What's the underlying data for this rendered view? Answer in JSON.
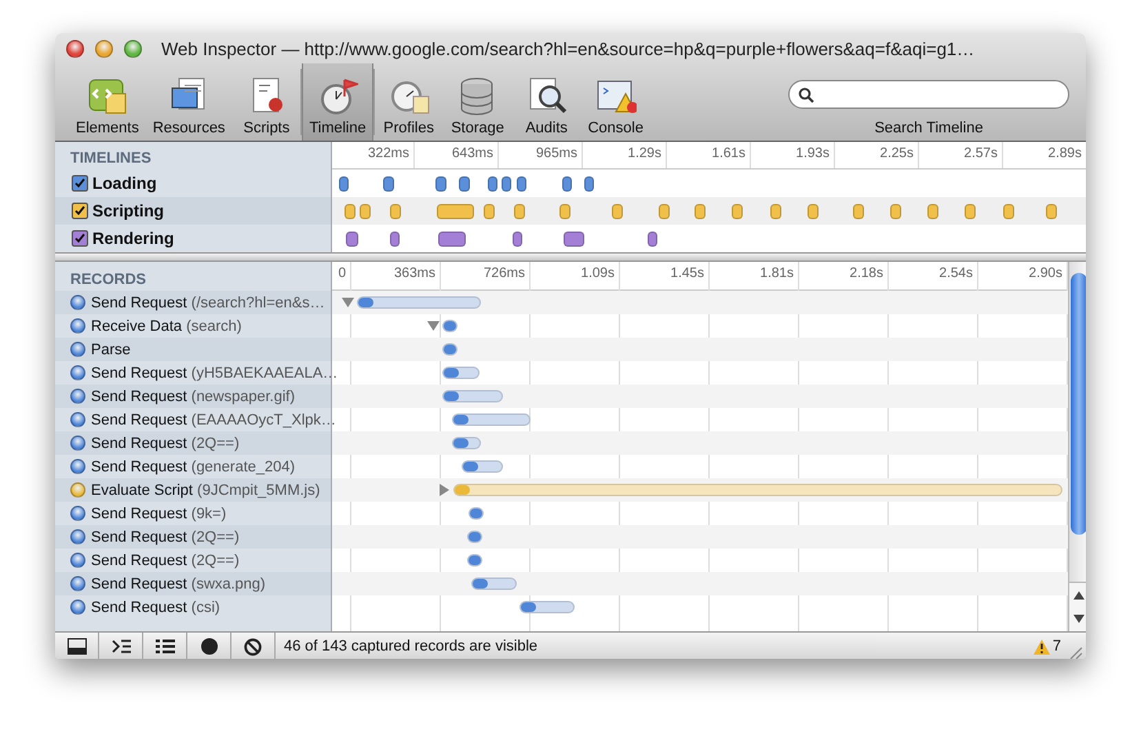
{
  "window": {
    "title": "Web Inspector — http://www.google.com/search?hl=en&source=hp&q=purple+flowers&aq=f&aqi=g1…"
  },
  "toolbar": {
    "items": [
      {
        "label": "Elements",
        "kind": "elements",
        "selected": false
      },
      {
        "label": "Resources",
        "kind": "resources",
        "selected": false
      },
      {
        "label": "Scripts",
        "kind": "scripts",
        "selected": false
      },
      {
        "label": "Timeline",
        "kind": "timeline",
        "selected": true
      },
      {
        "label": "Profiles",
        "kind": "profiles",
        "selected": false
      },
      {
        "label": "Storage",
        "kind": "storage",
        "selected": false
      },
      {
        "label": "Audits",
        "kind": "audits",
        "selected": false
      },
      {
        "label": "Console",
        "kind": "console",
        "selected": false
      }
    ],
    "search": {
      "label": "Search Timeline"
    }
  },
  "timelines": {
    "heading": "TIMELINES",
    "ticks": [
      "322ms",
      "643ms",
      "965ms",
      "1.29s",
      "1.61s",
      "1.93s",
      "2.25s",
      "2.57s",
      "2.89s"
    ],
    "rows": [
      {
        "label": "Loading",
        "checked": true,
        "color": "#5b8fd9"
      },
      {
        "label": "Scripting",
        "checked": true,
        "color": "#f0c04a"
      },
      {
        "label": "Rendering",
        "checked": true,
        "color": "#a47fd6"
      }
    ]
  },
  "records": {
    "heading": "RECORDS",
    "ticks": [
      "0",
      "363ms",
      "726ms",
      "1.09s",
      "1.45s",
      "1.81s",
      "2.18s",
      "2.54s",
      "2.90s"
    ],
    "rows": [
      {
        "name": "Send Request",
        "detail": "(/search?hl=en&s…",
        "kind": "network",
        "expanded": true
      },
      {
        "name": "Receive Data",
        "detail": "(search)",
        "kind": "network",
        "expanded": true
      },
      {
        "name": "Parse",
        "kind": "network"
      },
      {
        "name": "Send Request",
        "detail": "(yH5BAEKAAEALA…",
        "kind": "network"
      },
      {
        "name": "Send Request",
        "detail": "(newspaper.gif)",
        "kind": "network"
      },
      {
        "name": "Send Request",
        "detail": "(EAAAAOycT_Xlpk…",
        "kind": "network"
      },
      {
        "name": "Send Request",
        "detail": "(2Q==)",
        "kind": "network"
      },
      {
        "name": "Send Request",
        "detail": "(generate_204)",
        "kind": "network"
      },
      {
        "name": "Evaluate Script",
        "detail": "(9JCmpit_5MM.js)",
        "kind": "script",
        "expanded": false
      },
      {
        "name": "Send Request",
        "detail": "(9k=)",
        "kind": "network"
      },
      {
        "name": "Send Request",
        "detail": "(2Q==)",
        "kind": "network"
      },
      {
        "name": "Send Request",
        "detail": "(2Q==)",
        "kind": "network"
      },
      {
        "name": "Send Request",
        "detail": "(swxa.png)",
        "kind": "network"
      },
      {
        "name": "Send Request",
        "detail": "(csi)",
        "kind": "network"
      }
    ]
  },
  "status_bar": {
    "message": "46 of 143 captured records are visible",
    "warnings": "7"
  }
}
